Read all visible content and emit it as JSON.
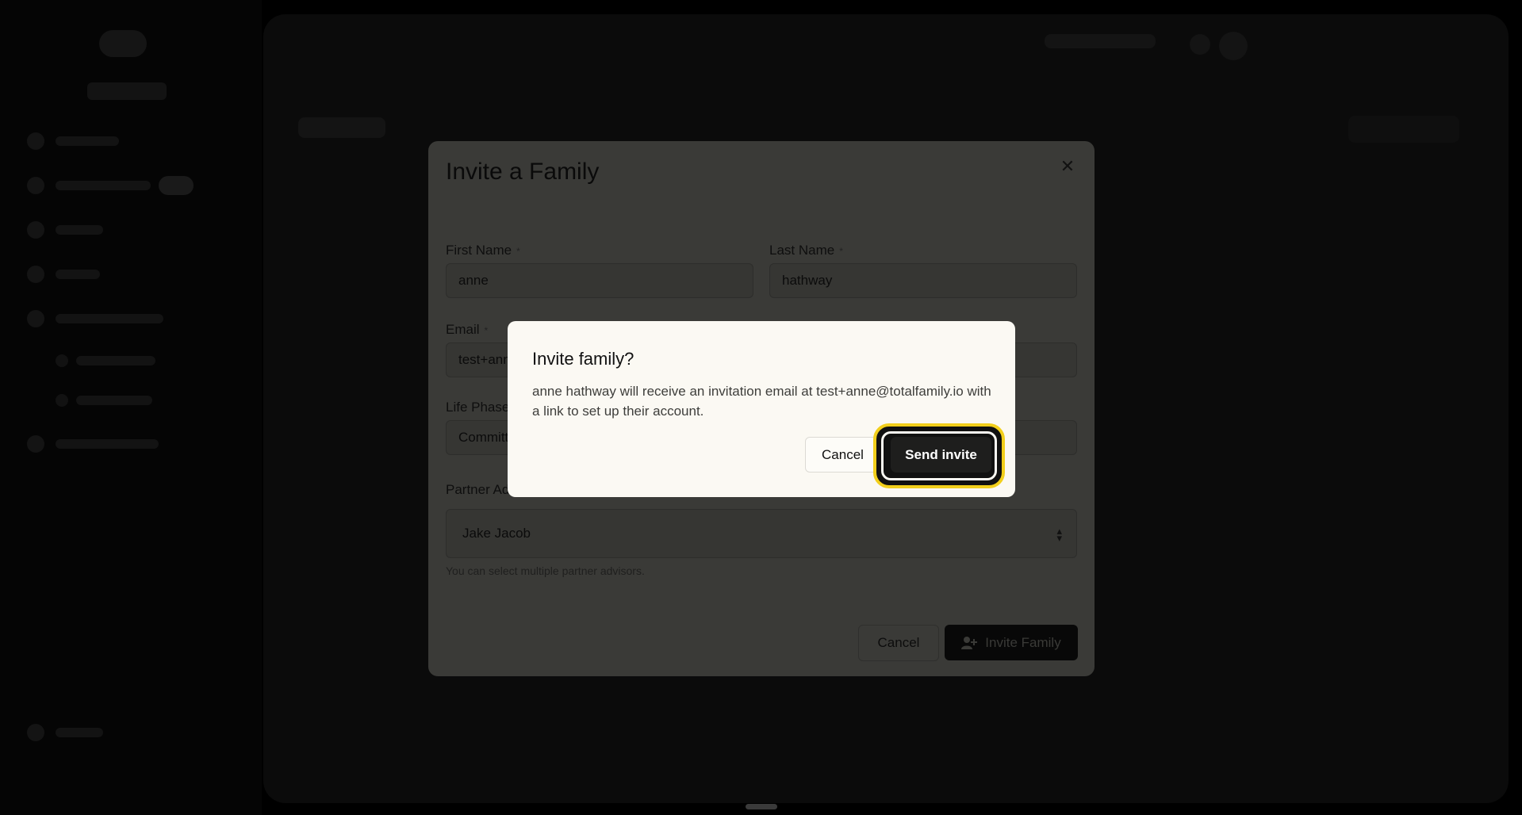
{
  "invite_modal": {
    "title": "Invite a Family",
    "first_name": {
      "label": "First Name",
      "required_mark": "*",
      "value": "anne"
    },
    "last_name": {
      "label": "Last Name",
      "required_mark": "*",
      "value": "hathway"
    },
    "email": {
      "label": "Email",
      "required_mark": "*",
      "value": "test+anne@totalfamily.io"
    },
    "life_phase": {
      "label": "Life Phase",
      "value": "Committed"
    },
    "partner_advisor": {
      "label": "Partner Advisor",
      "value": "Jake Jacob",
      "hint": "You can select multiple partner advisors."
    },
    "cancel_label": "Cancel",
    "submit_label": "Invite Family"
  },
  "confirm_dialog": {
    "title": "Invite family?",
    "body": "anne hathway will receive an invitation email at test+anne@totalfamily.io with a link to set up their account.",
    "cancel_label": "Cancel",
    "send_label": "Send invite"
  },
  "colors": {
    "focus_ring": "#f2cf1b",
    "dialog_bg": "#fbf9f3",
    "primary_button": "#1e1e1d"
  }
}
